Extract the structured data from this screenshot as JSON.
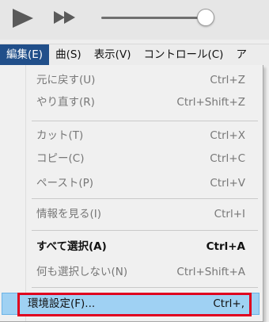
{
  "menubar": {
    "items": [
      {
        "label": "編集(E)"
      },
      {
        "label": "曲(S)"
      },
      {
        "label": "表示(V)"
      },
      {
        "label": "コントロール(C)"
      },
      {
        "label": "ア"
      }
    ]
  },
  "menu": {
    "items": [
      {
        "label": "元に戻す(U)",
        "shortcut": "Ctrl+Z"
      },
      {
        "label": "やり直す(R)",
        "shortcut": "Ctrl+Shift+Z"
      },
      {
        "label": "カット(T)",
        "shortcut": "Ctrl+X"
      },
      {
        "label": "コピー(C)",
        "shortcut": "Ctrl+C"
      },
      {
        "label": "ペースト(P)",
        "shortcut": "Ctrl+V"
      },
      {
        "label": "情報を見る(I)",
        "shortcut": "Ctrl+I"
      },
      {
        "label": "すべて選択(A)",
        "shortcut": "Ctrl+A"
      },
      {
        "label": "何も選択しない(N)",
        "shortcut": "Ctrl+Shift+A"
      },
      {
        "label": "環境設定(F)...",
        "shortcut": "Ctrl+,"
      }
    ]
  },
  "colors": {
    "active_menu_bg": "#214f8a",
    "highlight_bg": "#9fd1f3",
    "annotation_red": "#e0001e"
  },
  "icons": [
    "play-icon",
    "fast-forward-icon"
  ]
}
